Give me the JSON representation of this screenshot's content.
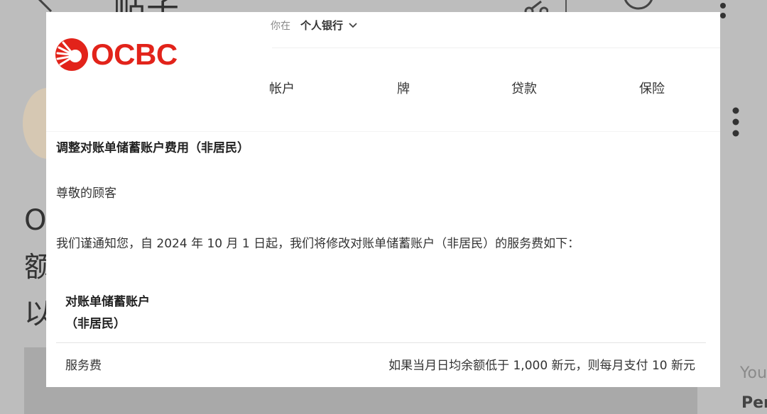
{
  "background": {
    "title_partial": "帖子",
    "text_lines": [
      "O",
      "额",
      "以"
    ],
    "right_text_1": "You",
    "right_text_2": "Per"
  },
  "brand": {
    "name": "OCBC",
    "color": "#e2231a",
    "logo_icon": "ocbc-sun-emblem-icon"
  },
  "location": {
    "label": "你在",
    "value": "个人银行"
  },
  "nav": {
    "items": [
      {
        "label": "帐户"
      },
      {
        "label": "牌"
      },
      {
        "label": "贷款"
      },
      {
        "label": "保险"
      }
    ]
  },
  "notice": {
    "title": "调整对账单储蓄账户费用（非居民）",
    "greeting": "尊敬的顾客",
    "intro": "我们谨通知您，自 2024 年 10 月 1 日起，我们将修改对账单储蓄账户（非居民）的服务费如下：",
    "table": {
      "header_line_1": "对账单储蓄账户",
      "header_line_2": "（非居民）",
      "rows": [
        {
          "label": "服务费",
          "value": "如果当月日均余额低于 1,000 新元，则每月支付 10 新元"
        }
      ]
    }
  }
}
